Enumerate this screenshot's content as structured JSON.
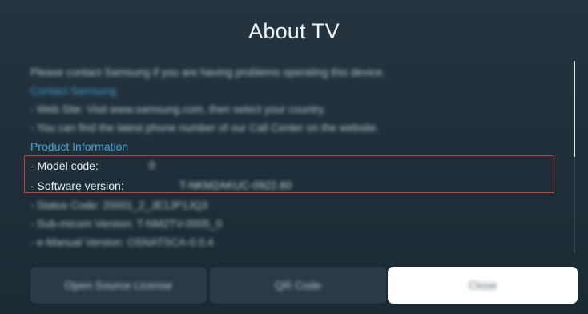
{
  "title": "About TV",
  "content": {
    "intro": "Please contact Samsung if you are having problems operating this device.",
    "contact_heading": "Contact Samsung",
    "contact_lines": [
      "- Web Site: Visit www.samsung.com, then select your country.",
      "- You can find the latest phone number of our Call Center on the website."
    ],
    "product_heading": "Product Information",
    "model_code_label": "- Model code:",
    "model_code_value": "0",
    "software_version_label": "- Software version:",
    "software_version_value": "T-NKM2AKUC-0922.60",
    "more_lines": [
      "- Status Code: 20001_2_JE1JP1JQ3",
      "- Sub-micom Version: T-NM2TV-0005_0",
      "- e-Manual Version: OSNATSCA-0.0.4"
    ]
  },
  "buttons": {
    "open_source": "Open Source License",
    "qr_code": "QR Code",
    "close": "Close"
  },
  "colors": {
    "highlight_border": "#d23a3a",
    "heading": "#4aa3d4",
    "close_button_bg": "#ffffff"
  }
}
